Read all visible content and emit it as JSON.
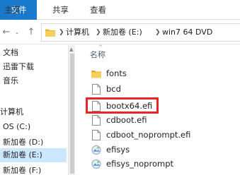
{
  "ribbon": {
    "tabs": [
      "文件",
      "主页",
      "共享",
      "查看"
    ]
  },
  "address": {
    "segments": [
      "计算机",
      "新加卷 (E:)",
      "win7  64 DVD"
    ]
  },
  "navpane": {
    "items": [
      "文档",
      "迅雷下载",
      "音乐",
      "",
      "计算机",
      "OS (C:)",
      "新加卷 (D:)",
      "新加卷 (E:)",
      "新加卷 (F:)"
    ],
    "selected": "新加卷 (E:)"
  },
  "content": {
    "column_name": "名称",
    "files": [
      {
        "name": "fonts",
        "type": "folder"
      },
      {
        "name": "bcd",
        "type": "file"
      },
      {
        "name": "bootx64.efi",
        "type": "file",
        "highlighted": true
      },
      {
        "name": "cdboot.efi",
        "type": "file"
      },
      {
        "name": "cdboot_noprompt.efi",
        "type": "file"
      },
      {
        "name": "efisys",
        "type": "image"
      },
      {
        "name": "efisys_noprompt",
        "type": "image"
      }
    ]
  },
  "colors": {
    "file_tab": "#1979ca",
    "selection": "#cce8ff",
    "highlight": "#e8262a",
    "folder": "#f1c24b"
  }
}
